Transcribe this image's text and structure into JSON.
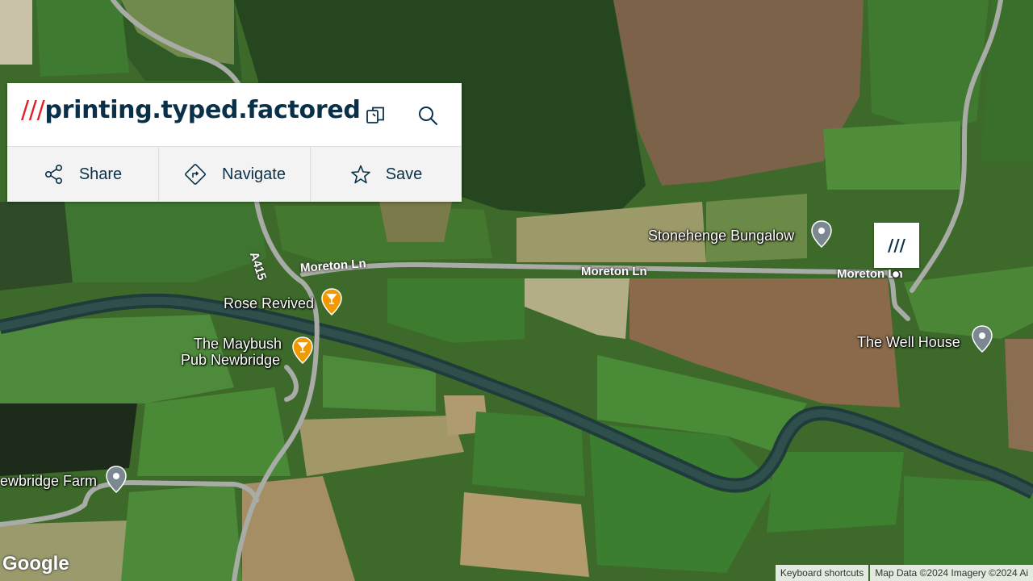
{
  "w3w": {
    "slashes": "///",
    "words": "printing.typed.factored",
    "actions": {
      "share": "Share",
      "navigate": "Navigate",
      "save": "Save"
    },
    "marker_label": "///",
    "icons": {
      "copy": "copy-icon",
      "search": "search-icon",
      "share": "share-icon",
      "navigate": "navigate-icon",
      "save": "star-icon"
    },
    "colors": {
      "slashes": "#e11f26",
      "text": "#0a3049"
    }
  },
  "map": {
    "roads": {
      "moreton_ln_1": "Moreton Ln",
      "moreton_ln_2": "Moreton Ln",
      "moreton_ln_3": "Moreton Ln",
      "a415": "A415"
    },
    "places": {
      "stonehenge": "Stonehenge Bungalow",
      "rose_revived": "Rose Revived",
      "maybush_1": "The Maybush",
      "maybush_2": "Pub Newbridge",
      "well_house": "The Well House",
      "newbridge_farm": "ewbridge Farm"
    },
    "pin_colors": {
      "place": "#7b8791",
      "restaurant": "#f29900"
    }
  },
  "footer": {
    "logo": "Google",
    "keyboard": "Keyboard shortcuts",
    "attribution": "Map Data ©2024 Imagery ©2024 Ai"
  }
}
